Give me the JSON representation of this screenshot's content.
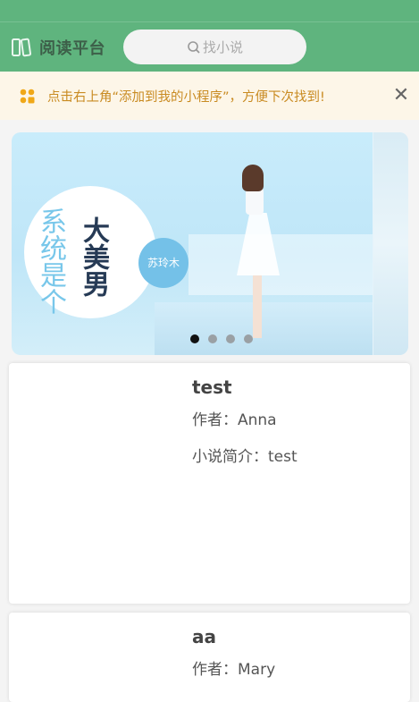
{
  "header": {
    "logo_icon": "book-icon",
    "title": "阅读平台",
    "search_placeholder": "找小说",
    "accent": "#5fb47e"
  },
  "tip": {
    "icon": "mini-program-dots-icon",
    "text": "点击右上角“添加到我的小程序”，方便下次找到!",
    "close": "✕",
    "color": "#c98b22"
  },
  "banner": {
    "title_main": "大美男",
    "title_sub": "系统是个",
    "author_badge": "苏玲木",
    "slide_count": 4,
    "active_slide": 1
  },
  "books": [
    {
      "title": "test",
      "author": "作者：Anna",
      "description": "小说简介：test"
    },
    {
      "title": "aa",
      "author": "作者：Mary"
    }
  ]
}
